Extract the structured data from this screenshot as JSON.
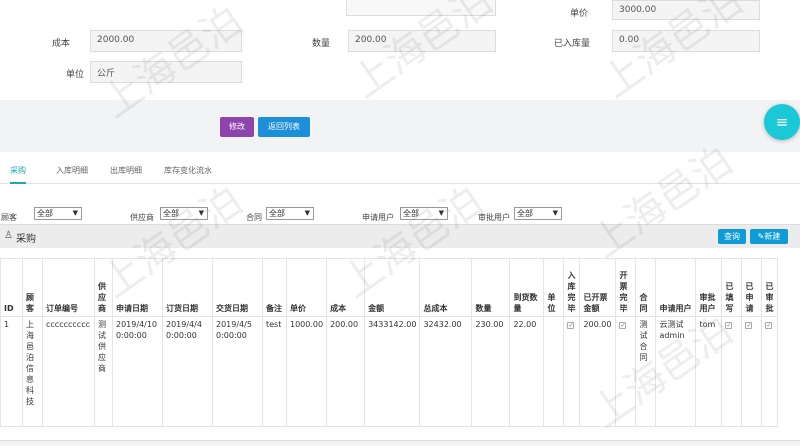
{
  "form": {
    "unit_price_label": "单价",
    "unit_price_value": "3000.00",
    "cost_label": "成本",
    "cost_value": "2000.00",
    "quantity_label": "数量",
    "quantity_value": "200.00",
    "stocked_label": "已入库量",
    "stocked_value": "0.00",
    "unit_label": "单位",
    "unit_value": "公斤"
  },
  "actions": {
    "edit": "修改",
    "back": "返回列表"
  },
  "tabs": [
    "采购",
    "入库明细",
    "出库明细",
    "库存变化流水"
  ],
  "filters": {
    "customer_label": "顾客",
    "supplier_label": "供应商",
    "contract_label": "合同",
    "applicant_label": "申请用户",
    "approver_label": "审批用户",
    "all": "全部"
  },
  "panel": {
    "title": "采购",
    "query": "查询",
    "add": "新建"
  },
  "table": {
    "headers": [
      "ID",
      "顾客",
      "订单编号",
      "供应商",
      "申请日期",
      "订货日期",
      "交货日期",
      "备注",
      "单价",
      "成本",
      "金额",
      "总成本",
      "数量",
      "到货数量",
      "单位",
      "入库完毕",
      "已开票金额",
      "开票完毕",
      "合同",
      "申请用户",
      "审批用户",
      "已填写",
      "已申请",
      "已审批"
    ],
    "rows": [
      [
        "1",
        "上海邑泊信息科技",
        "cccccccccc",
        "测试供应商",
        "2019/4/10 0:00:00",
        "2019/4/4 0:00:00",
        "2019/4/5 0:00:00",
        "test",
        "1000.00",
        "200.00",
        "3433142.00",
        "32432.00",
        "230.00",
        "22.00",
        "",
        "✓",
        "200.00",
        "✓",
        "测试合同",
        "云测试admin",
        "tom",
        "✓",
        "✓",
        "✓"
      ]
    ]
  },
  "watermark": "上海邑泊"
}
